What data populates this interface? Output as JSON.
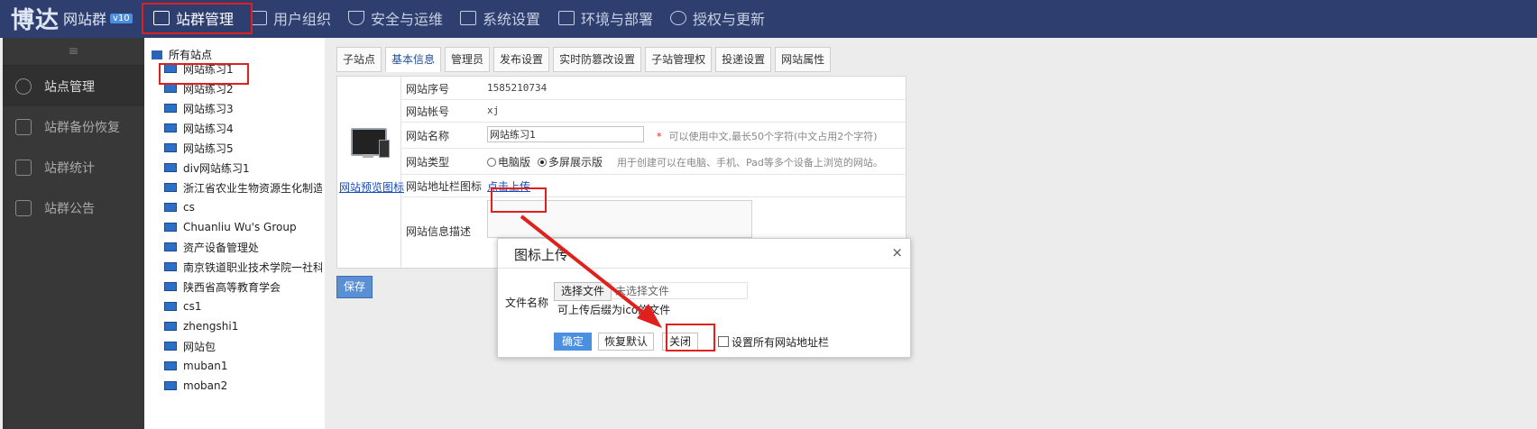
{
  "brand": {
    "name": "博达",
    "product": "网站群",
    "version": "v10"
  },
  "topnav": [
    {
      "label": "站群管理",
      "active": true
    },
    {
      "label": "用户组织"
    },
    {
      "label": "安全与运维"
    },
    {
      "label": "系统设置"
    },
    {
      "label": "环境与部署"
    },
    {
      "label": "授权与更新"
    }
  ],
  "sidebar": {
    "toggle": "≡",
    "items": [
      {
        "label": "站点管理",
        "active": true
      },
      {
        "label": "站群备份恢复"
      },
      {
        "label": "站群统计"
      },
      {
        "label": "站群公告"
      }
    ]
  },
  "tree": {
    "root": "所有站点",
    "nodes": [
      "网站练习1",
      "网站练习2",
      "网站练习3",
      "网站练习4",
      "网站练习5",
      "div网站练习1",
      "浙江省农业生物资源生化制造",
      "cs",
      "Chuanliu Wu's Group",
      "资产设备管理处",
      "南京铁道职业技术学院一社科",
      "陕西省高等教育学会",
      "cs1",
      "zhengshi1",
      "网站包",
      "muban1",
      "moban2"
    ]
  },
  "tabs": [
    "子站点",
    "基本信息",
    "管理员",
    "发布设置",
    "实时防篡改设置",
    "子站管理权",
    "投递设置",
    "网站属性"
  ],
  "form": {
    "preview_link": "网站预览图标",
    "fields": {
      "seq_label": "网站序号",
      "seq_value": "1585210734",
      "account_label": "网站帐号",
      "account_value": "xj",
      "name_label": "网站名称",
      "name_value": "网站练习1",
      "name_hint": "可以使用中文,最长50个字符(中文占用2个字符)",
      "required_mark": "*",
      "type_label": "网站类型",
      "type_option1": "电脑版",
      "type_option2": "多屏展示版",
      "type_hint": "用于创建可以在电脑、手机、Pad等多个设备上浏览的网站。",
      "favicon_label": "网站地址栏图标",
      "favicon_link": "点击上传",
      "desc_label": "网站信息描述"
    },
    "save": "保存"
  },
  "dialog": {
    "title": "图标上传",
    "close": "×",
    "file_label": "文件名称",
    "file_button": "选择文件",
    "file_status": "未选择文件",
    "note": "可上传后缀为ico的文件",
    "ok": "确定",
    "restore": "恢复默认",
    "close_btn": "关闭",
    "apply_all": "设置所有网站地址栏"
  },
  "annotation_color": "#e0201c"
}
